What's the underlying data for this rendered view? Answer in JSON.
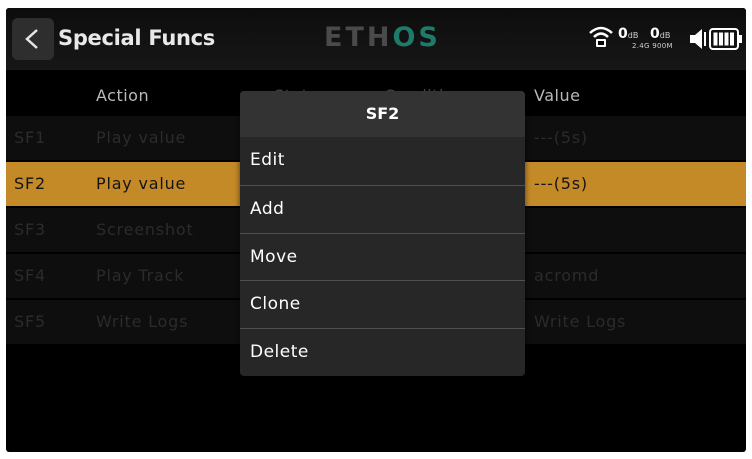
{
  "header": {
    "title": "Special Funcs",
    "logo_main": "ETH",
    "logo_accent": "OS",
    "rssi_1": "0",
    "rssi_1_unit": "dB",
    "rssi_2": "0",
    "rssi_2_unit": "dB",
    "bands": "2.4G 900M",
    "icons": [
      "back-arrow-icon",
      "wifi-signal-icon",
      "volume-icon",
      "battery-icon"
    ]
  },
  "columns": {
    "id": "",
    "action": "Action",
    "state": "State",
    "condition": "Condition",
    "value": "Value"
  },
  "rows": [
    {
      "id": "SF1",
      "action": "Play value",
      "value": "---(5s)"
    },
    {
      "id": "SF2",
      "action": "Play value",
      "value": "---(5s)",
      "selected": true
    },
    {
      "id": "SF3",
      "action": "Screenshot",
      "value": ""
    },
    {
      "id": "SF4",
      "action": "Play Track",
      "value": "acromd"
    },
    {
      "id": "SF5",
      "action": "Write Logs",
      "value": "Write Logs"
    }
  ],
  "popup": {
    "title": "SF2",
    "items": [
      "Edit",
      "Add",
      "Move",
      "Clone",
      "Delete"
    ]
  },
  "colors": {
    "selected_row": "#c48a27",
    "logo_accent": "#1f7a6a"
  }
}
